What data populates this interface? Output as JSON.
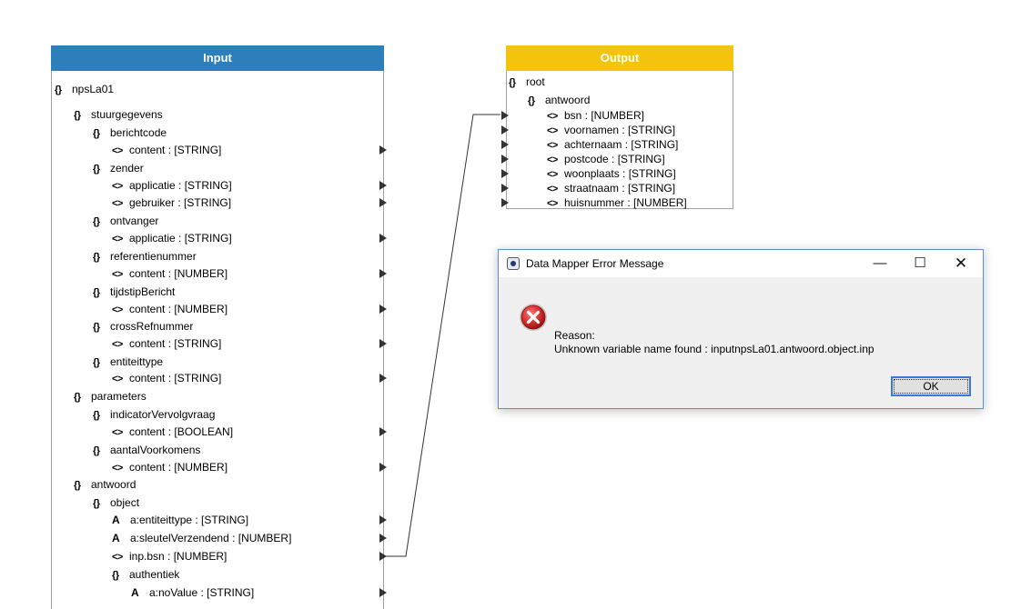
{
  "input_panel": {
    "title": "Input",
    "nodes": [
      {
        "icon": "{}",
        "label": "npsLa01",
        "depth": 0
      },
      {
        "icon": "{}",
        "label": "stuurgegevens",
        "depth": 1
      },
      {
        "icon": "{}",
        "label": "berichtcode",
        "depth": 2
      },
      {
        "icon": "<>",
        "label": "content  : [STRING]",
        "depth": 3,
        "port": true
      },
      {
        "icon": "{}",
        "label": "zender",
        "depth": 2
      },
      {
        "icon": "<>",
        "label": "applicatie  : [STRING]",
        "depth": 3,
        "port": true
      },
      {
        "icon": "<>",
        "label": "gebruiker  : [STRING]",
        "depth": 3,
        "port": true
      },
      {
        "icon": "{}",
        "label": "ontvanger",
        "depth": 2
      },
      {
        "icon": "<>",
        "label": "applicatie  : [STRING]",
        "depth": 3,
        "port": true
      },
      {
        "icon": "{}",
        "label": "referentienummer",
        "depth": 2
      },
      {
        "icon": "<>",
        "label": "content  : [NUMBER]",
        "depth": 3,
        "port": true
      },
      {
        "icon": "{}",
        "label": "tijdstipBericht",
        "depth": 2
      },
      {
        "icon": "<>",
        "label": "content  : [NUMBER]",
        "depth": 3,
        "port": true
      },
      {
        "icon": "{}",
        "label": "crossRefnummer",
        "depth": 2
      },
      {
        "icon": "<>",
        "label": "content  : [STRING]",
        "depth": 3,
        "port": true
      },
      {
        "icon": "{}",
        "label": "entiteittype",
        "depth": 2
      },
      {
        "icon": "<>",
        "label": "content  : [STRING]",
        "depth": 3,
        "port": true
      },
      {
        "icon": "{}",
        "label": "parameters",
        "depth": 1
      },
      {
        "icon": "{}",
        "label": "indicatorVervolgvraag",
        "depth": 2
      },
      {
        "icon": "<>",
        "label": "content  : [BOOLEAN]",
        "depth": 3,
        "port": true
      },
      {
        "icon": "{}",
        "label": "aantalVoorkomens",
        "depth": 2
      },
      {
        "icon": "<>",
        "label": "content  : [NUMBER]",
        "depth": 3,
        "port": true
      },
      {
        "icon": "{}",
        "label": "antwoord",
        "depth": 1
      },
      {
        "icon": "{}",
        "label": "object",
        "depth": 2
      },
      {
        "icon": "A",
        "label": "a:entiteittype  : [STRING]",
        "depth": 3,
        "port": true
      },
      {
        "icon": "A",
        "label": "a:sleutelVerzendend  : [NUMBER]",
        "depth": 3,
        "port": true
      },
      {
        "icon": "<>",
        "label": "inp.bsn  : [NUMBER]",
        "depth": 3,
        "port": true
      },
      {
        "icon": "{}",
        "label": "authentiek",
        "depth": 3
      },
      {
        "icon": "A",
        "label": "a:noValue  : [STRING]",
        "depth": 4,
        "port": true
      }
    ]
  },
  "output_panel": {
    "title": "Output",
    "nodes": [
      {
        "icon": "{}",
        "label": "root",
        "depth": 0
      },
      {
        "icon": "{}",
        "label": "antwoord",
        "depth": 1
      },
      {
        "icon": "<>",
        "label": "bsn  : [NUMBER]",
        "depth": 2,
        "port": true
      },
      {
        "icon": "<>",
        "label": "voornamen  : [STRING]",
        "depth": 2,
        "port": true
      },
      {
        "icon": "<>",
        "label": "achternaam  : [STRING]",
        "depth": 2,
        "port": true
      },
      {
        "icon": "<>",
        "label": "postcode  : [STRING]",
        "depth": 2,
        "port": true
      },
      {
        "icon": "<>",
        "label": "woonplaats  : [STRING]",
        "depth": 2,
        "port": true
      },
      {
        "icon": "<>",
        "label": "straatnaam  : [STRING]",
        "depth": 2,
        "port": true
      },
      {
        "icon": "<>",
        "label": "huisnummer  : [NUMBER]",
        "depth": 2,
        "port": true
      }
    ]
  },
  "mapping": {
    "from": "inp.bsn  : [NUMBER]",
    "to": "bsn  : [NUMBER]"
  },
  "dialog": {
    "title": "Data Mapper Error Message",
    "minimize_glyph": "—",
    "maximize_glyph": "☐",
    "close_glyph": "✕",
    "reason_label": "Reason:",
    "reason_text": "Unknown variable name found : inputnpsLa01.antwoord.object.inp",
    "ok_label": "OK",
    "icon": "error-icon"
  },
  "colors": {
    "input_header": "#2c7fba",
    "output_header": "#f3c30e",
    "error_red": "#d32f2f"
  }
}
